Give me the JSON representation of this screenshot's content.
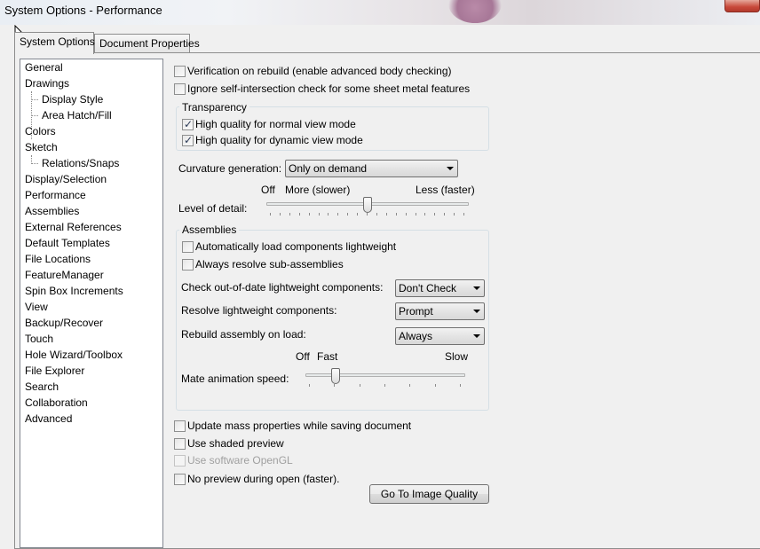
{
  "window": {
    "title": "System Options - Performance"
  },
  "tabs": [
    {
      "label": "System Options",
      "active": true
    },
    {
      "label": "Document Properties",
      "active": false
    }
  ],
  "tree": {
    "items": [
      {
        "label": "General",
        "level": 0
      },
      {
        "label": "Drawings",
        "level": 0
      },
      {
        "label": "Display Style",
        "level": 1
      },
      {
        "label": "Area Hatch/Fill",
        "level": 1
      },
      {
        "label": "Colors",
        "level": 0
      },
      {
        "label": "Sketch",
        "level": 0
      },
      {
        "label": "Relations/Snaps",
        "level": 1
      },
      {
        "label": "Display/Selection",
        "level": 0
      },
      {
        "label": "Performance",
        "level": 0,
        "selected": true
      },
      {
        "label": "Assemblies",
        "level": 0
      },
      {
        "label": "External References",
        "level": 0
      },
      {
        "label": "Default Templates",
        "level": 0
      },
      {
        "label": "File Locations",
        "level": 0
      },
      {
        "label": "FeatureManager",
        "level": 0
      },
      {
        "label": "Spin Box Increments",
        "level": 0
      },
      {
        "label": "View",
        "level": 0
      },
      {
        "label": "Backup/Recover",
        "level": 0
      },
      {
        "label": "Touch",
        "level": 0
      },
      {
        "label": "Hole Wizard/Toolbox",
        "level": 0
      },
      {
        "label": "File Explorer",
        "level": 0
      },
      {
        "label": "Search",
        "level": 0
      },
      {
        "label": "Collaboration",
        "level": 0
      },
      {
        "label": "Advanced",
        "level": 0
      }
    ]
  },
  "performance": {
    "verification": {
      "label": "Verification on rebuild (enable advanced body checking)",
      "checked": false
    },
    "ignore_self_intersection": {
      "label": "Ignore self-intersection check for some sheet metal features",
      "checked": false
    },
    "transparency": {
      "title": "Transparency",
      "normal": {
        "label": "High quality for normal view mode",
        "checked": true
      },
      "dynamic": {
        "label": "High quality for dynamic view mode",
        "checked": true
      }
    },
    "curvature": {
      "label": "Curvature generation:",
      "value": "Only on demand"
    },
    "level_of_detail": {
      "label": "Level of detail:",
      "off_label": "Off",
      "more_label": "More (slower)",
      "less_label": "Less (faster)",
      "value_fraction": 0.5
    },
    "assemblies": {
      "title": "Assemblies",
      "auto_lightweight": {
        "label": "Automatically load components lightweight",
        "checked": false
      },
      "always_resolve": {
        "label": "Always resolve sub-assemblies",
        "checked": false
      },
      "check_out_of_date": {
        "label": "Check out-of-date lightweight components:",
        "value": "Don't Check"
      },
      "resolve_lightweight": {
        "label": "Resolve lightweight components:",
        "value": "Prompt"
      },
      "rebuild_on_load": {
        "label": "Rebuild assembly on load:",
        "value": "Always"
      },
      "mate_animation": {
        "label": "Mate animation speed:",
        "off_label": "Off",
        "fast_label": "Fast",
        "slow_label": "Slow",
        "value_fraction": 0.17
      }
    },
    "update_mass": {
      "label": "Update mass properties while saving document",
      "checked": false
    },
    "shaded_preview": {
      "label": "Use shaded preview",
      "checked": false
    },
    "software_opengl": {
      "label": "Use software OpenGL",
      "checked": false,
      "disabled": true
    },
    "no_preview": {
      "label": "No preview during open (faster).",
      "checked": false
    },
    "image_quality_button": "Go To Image Quality"
  }
}
